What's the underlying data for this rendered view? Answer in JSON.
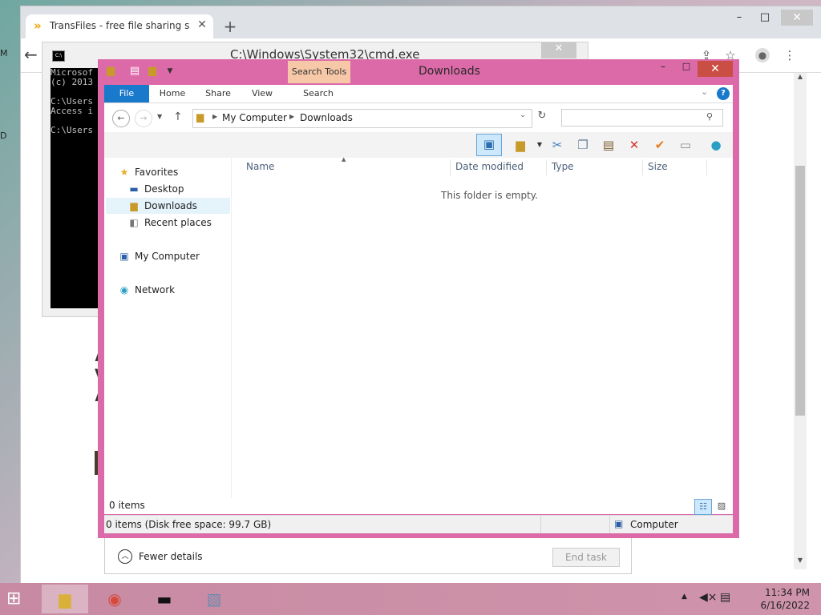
{
  "desktop": {
    "edge_label_1": "M",
    "edge_label_2": "D"
  },
  "chrome": {
    "tab_title": "TransFiles - free file sharing servi",
    "tab_favicon": "transfiles-logo-icon",
    "newtab_glyph": "+",
    "minimize_glyph": "–",
    "maximize_glyph": "□",
    "close_glyph": "✕",
    "back_glyph": "←",
    "page_peek": [
      "A",
      "V",
      "A"
    ]
  },
  "cmd": {
    "title": "C:\\Windows\\System32\\cmd.exe",
    "lines": [
      "Microsof",
      "(c) 2013",
      "",
      "C:\\Users",
      "Access i",
      "",
      "C:\\Users"
    ]
  },
  "taskmgr": {
    "fewer_details": "Fewer details",
    "end_task": "End task"
  },
  "explorer": {
    "title": "Downloads",
    "contextual_tab": "Search Tools",
    "ribbon_tabs": [
      "File",
      "Home",
      "Share",
      "View",
      "Search"
    ],
    "breadcrumb": [
      "My Computer",
      "Downloads"
    ],
    "search_placeholder": "",
    "nav": {
      "favorites": "Favorites",
      "desktop": "Desktop",
      "downloads": "Downloads",
      "recent": "Recent places",
      "computer": "My Computer",
      "network": "Network"
    },
    "columns": [
      "Name",
      "Date modified",
      "Type",
      "Size"
    ],
    "empty_message": "This folder is empty.",
    "item_count": "0 items",
    "status_left": "0 items (Disk free space: 99.7 GB)",
    "status_right": "Computer",
    "accent_color": "#1979ca",
    "frame_color": "#dc6aa9"
  },
  "taskbar": {
    "time": "11:34 PM",
    "date": "6/16/2022",
    "apps": [
      "file-explorer-icon",
      "chrome-icon",
      "cmd-icon",
      "resource-monitor-icon"
    ]
  }
}
